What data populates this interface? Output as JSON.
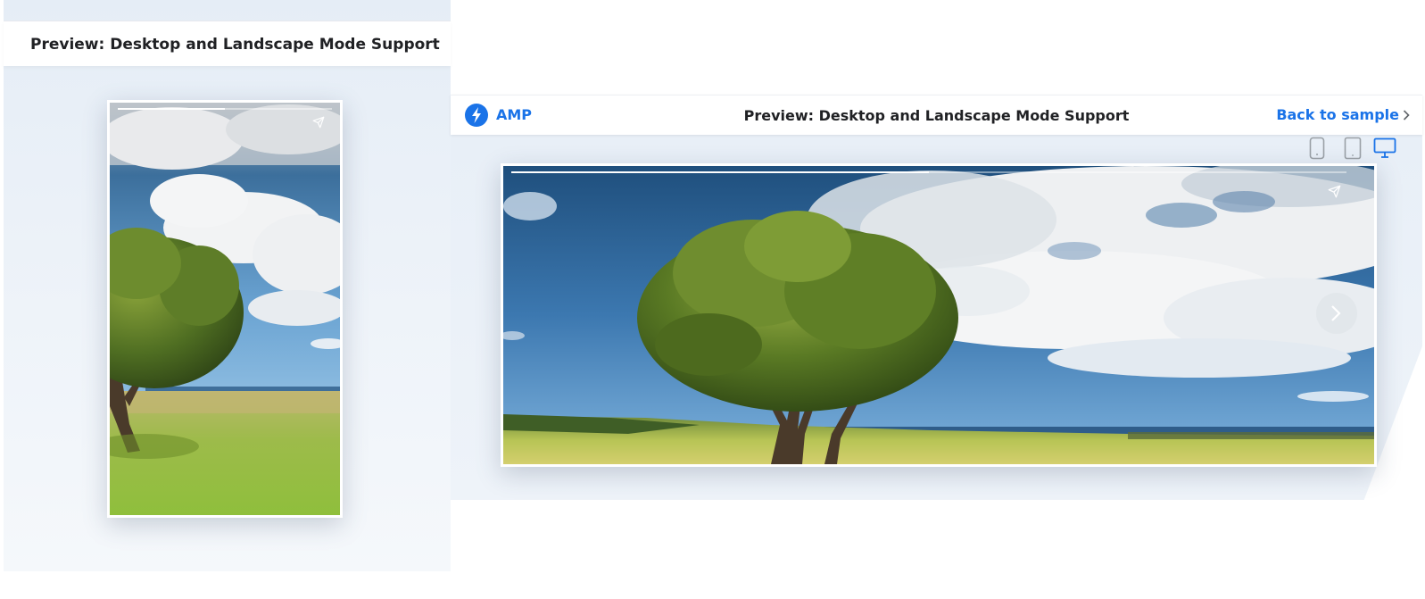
{
  "left_panel": {
    "title": "Preview: Desktop and Landscape Mode Support",
    "story": {
      "progress": 0.5
    }
  },
  "right_panel": {
    "logo_label": "AMP",
    "title": "Preview: Desktop and Landscape Mode Support",
    "back_link": "Back to sample",
    "devices": [
      {
        "name": "phone",
        "active": false
      },
      {
        "name": "tablet",
        "active": false
      },
      {
        "name": "desktop",
        "active": true
      }
    ],
    "story": {
      "progress": 0.5
    }
  },
  "icons": {
    "amp": "lightning-bolt-icon",
    "back": "chevron-right-icon",
    "share": "paper-plane-icon",
    "next": "chevron-right-icon"
  },
  "colors": {
    "accent": "#1a73e8",
    "title": "#202124",
    "inactive_icon": "#9aa0a6"
  }
}
